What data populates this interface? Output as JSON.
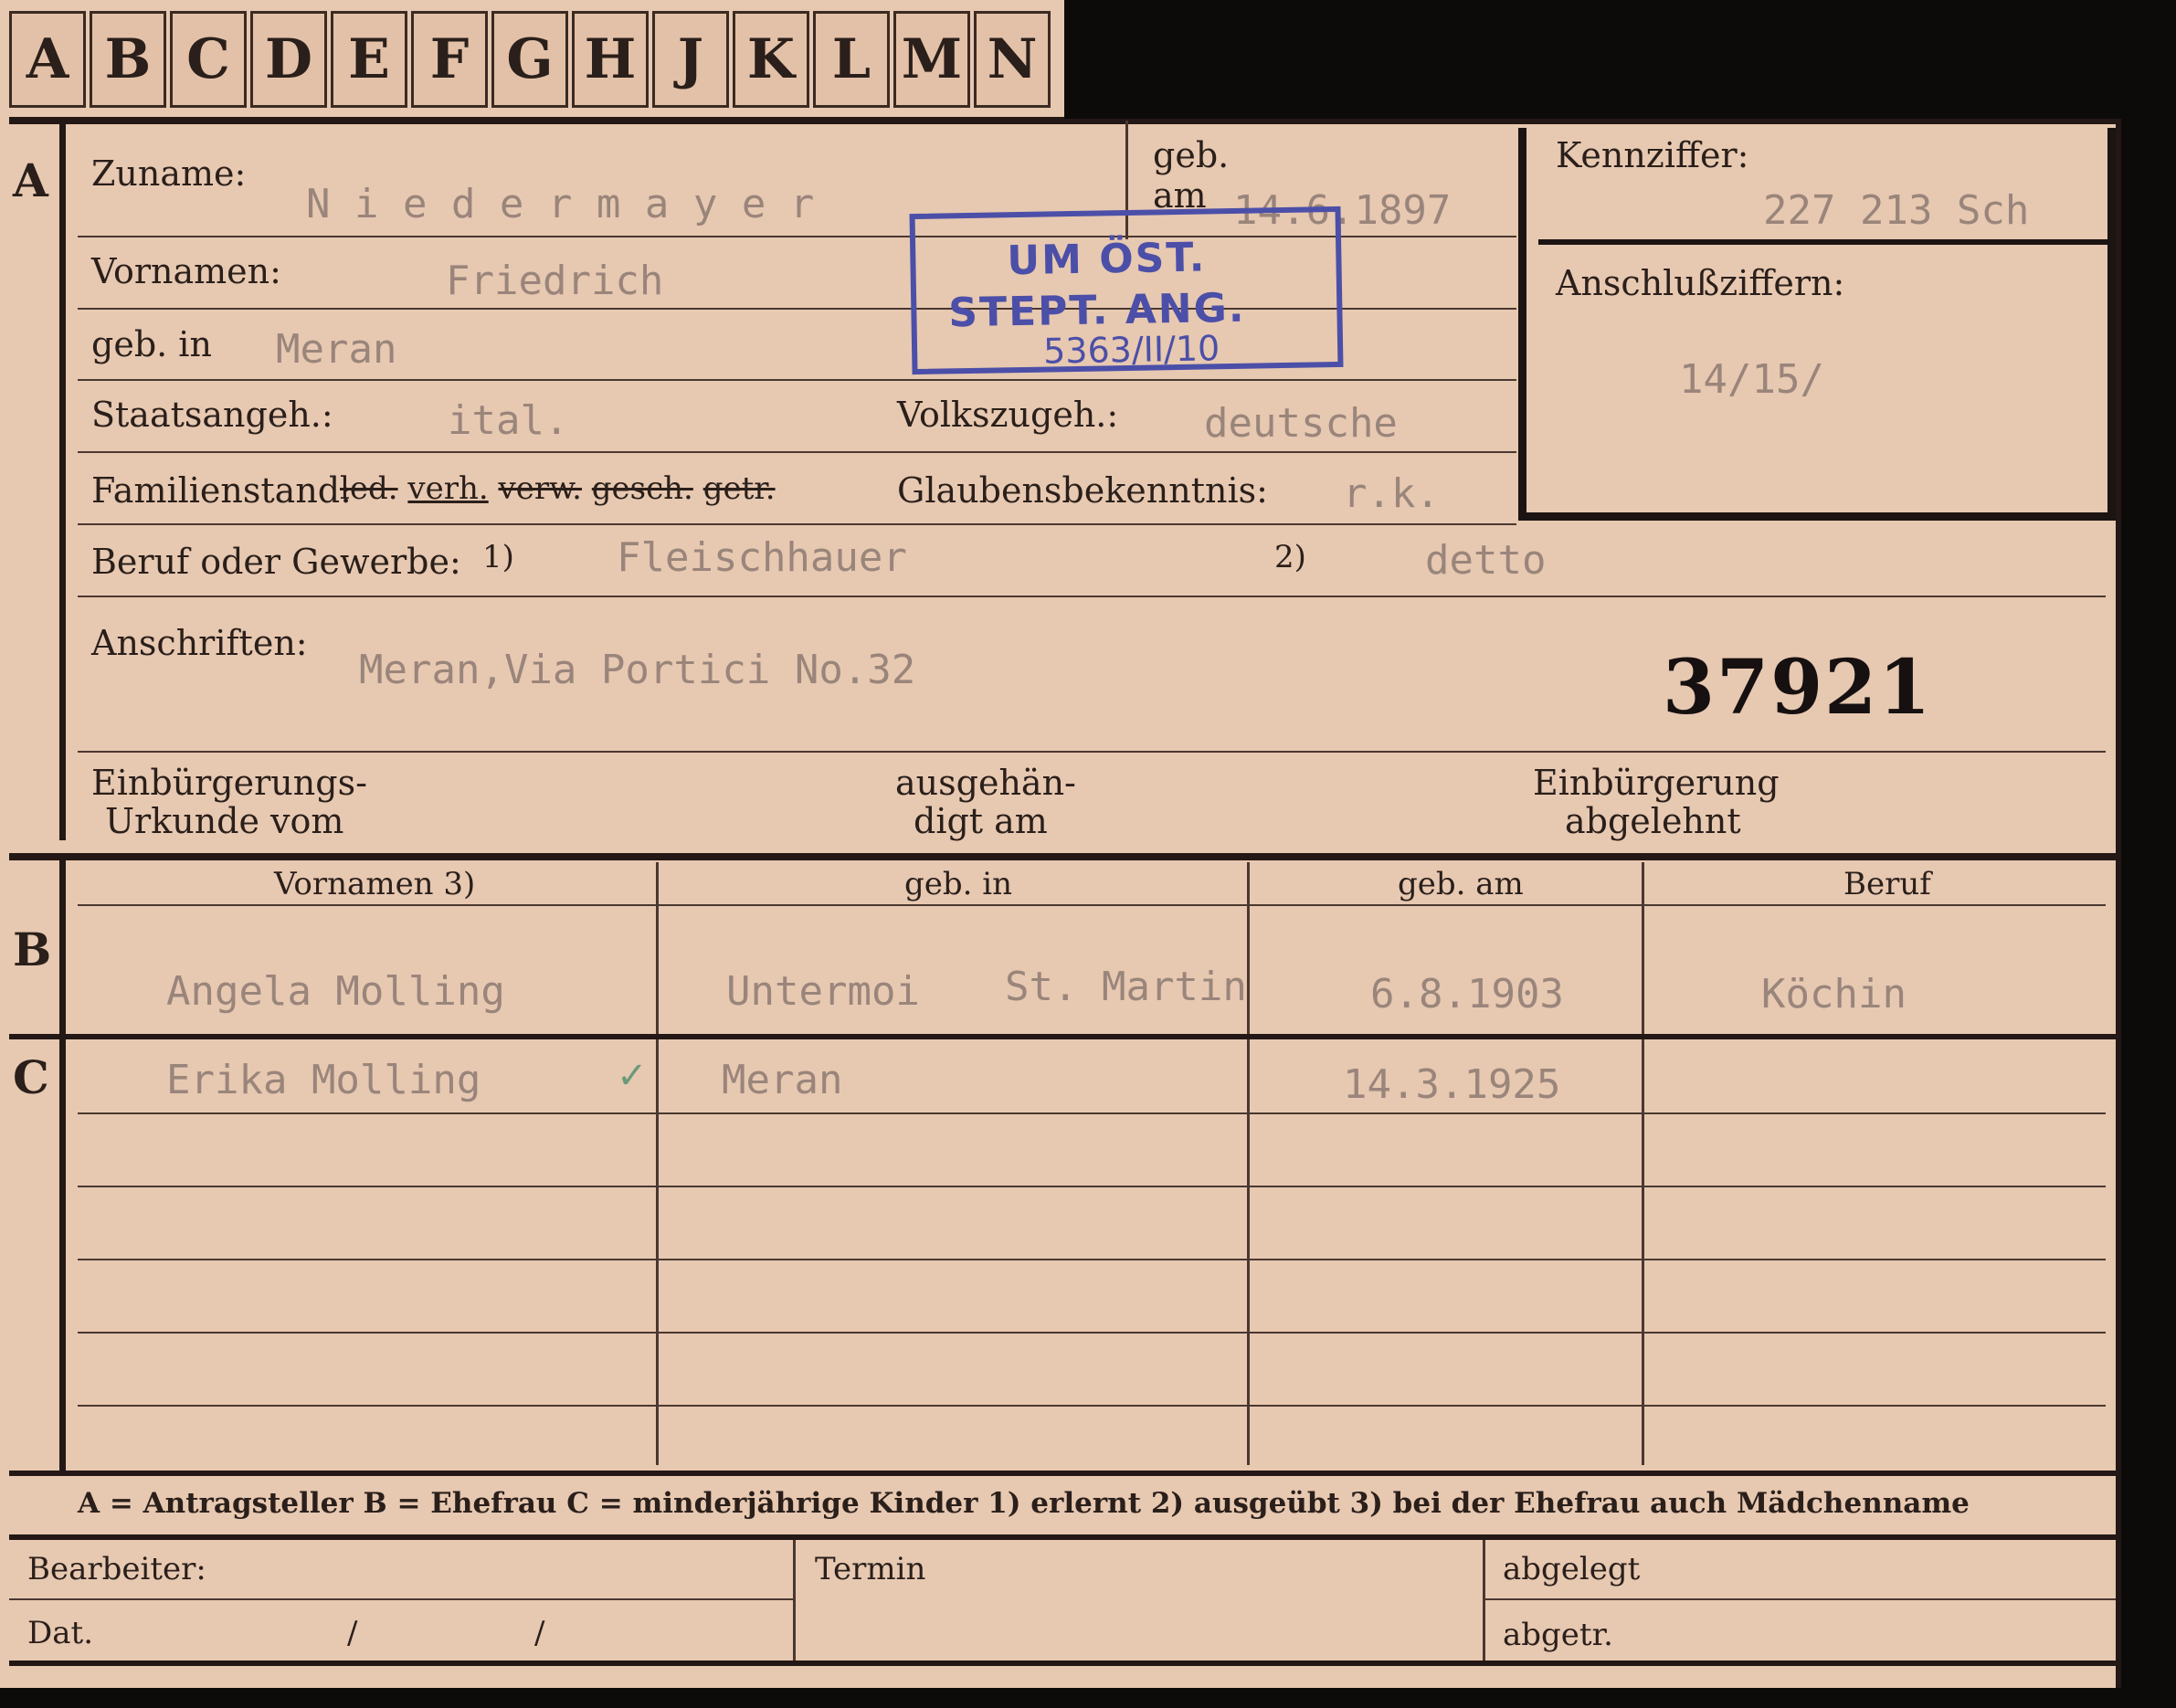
{
  "tabs": [
    "A",
    "B",
    "C",
    "D",
    "E",
    "F",
    "G",
    "H",
    "J",
    "K",
    "L",
    "M",
    "N"
  ],
  "section_letters": {
    "a": "A",
    "b": "B",
    "c": "C"
  },
  "applicant": {
    "surname_label": "Zuname:",
    "surname": "N i e d e r m a y e r",
    "birthdate_label_1": "geb.",
    "birthdate_label_2": "am",
    "birthdate": "14.6.1897",
    "firstnames_label": "Vornamen:",
    "firstnames": "Friedrich",
    "birthplace_label": "geb. in",
    "birthplace": "Meran",
    "citizenship_label": "Staatsangeh.:",
    "citizenship": "ital.",
    "nationality_label": "Volkszugeh.:",
    "nationality": "deutsche",
    "marital_label": "Familienstand:",
    "marital_options": [
      "led.",
      "verh.",
      "verw.",
      "gesch.",
      "getr."
    ],
    "religion_label": "Glaubensbekenntnis:",
    "religion": "r.k.",
    "occupation_label": "Beruf oder Gewerbe:",
    "occupation_note_1": "1)",
    "occupation": "Fleischhauer",
    "occupation_note_2": "2)",
    "occupation_2": "detto",
    "address_label": "Anschriften:",
    "address": "Meran,Via Portici No.32",
    "file_number": "37921",
    "naturalization_label_1": "Einbürgerungs-",
    "naturalization_label_2": "Urkunde vom",
    "delivered_label_1": "ausgehän-",
    "delivered_label_2": "digt am",
    "rejected_label_1": "Einbürgerung",
    "rejected_label_2": "abgelehnt"
  },
  "kennziffer": {
    "label": "Kennziffer:",
    "value": "227 213 Sch",
    "anschluss_label": "Anschlußziffern:",
    "anschluss_value": "14/15/"
  },
  "stamp": {
    "line1": "UM ÖST.",
    "line2": "STEPT. ANG.",
    "line3": "5363/II/10",
    "color": "#4b4fa8"
  },
  "family_table": {
    "headers": [
      "Vornamen 3)",
      "geb. in",
      "geb. am",
      "Beruf"
    ],
    "spouse": {
      "firstnames": "Angela   Molling",
      "birthplace_1": "Untermoi",
      "birthplace_2": "St. Martin",
      "birthdate": "6.8.1903",
      "occupation": "Köchin"
    },
    "child": {
      "firstnames": "Erika    Molling",
      "birthplace": "Meran",
      "birthdate": "14.3.1925",
      "check": "✓"
    }
  },
  "legend": "A = Antragsteller   B = Ehefrau   C = minderjährige Kinder   1) erlernt   2) ausgeübt   3) bei der Ehefrau auch Mädchenname",
  "footer": {
    "clerk_label": "Bearbeiter:",
    "date_label": "Dat.",
    "date_sep_1": "/",
    "date_sep_2": "/",
    "term_label": "Termin",
    "filed_label": "abgelegt",
    "sent_label": "abgetr."
  }
}
